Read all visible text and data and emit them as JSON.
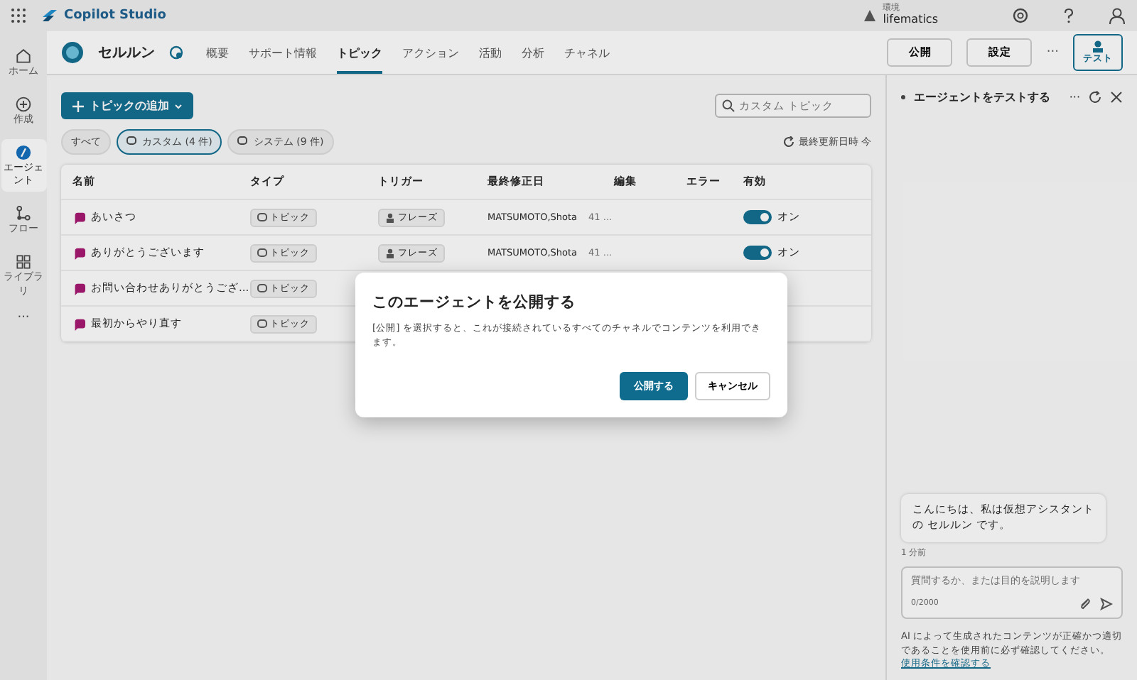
{
  "app": {
    "title": "Copilot Studio",
    "environment_label": "環境",
    "environment": "lifematics"
  },
  "rail": [
    {
      "label": "ホーム",
      "selected": false
    },
    {
      "label": "作成",
      "selected": false
    },
    {
      "label": "エージェント",
      "selected": true
    },
    {
      "label": "フロー",
      "selected": false
    },
    {
      "label": "ライブラリ",
      "selected": false
    }
  ],
  "rail_more": "···",
  "agent": {
    "name": "セルルン"
  },
  "nav_tabs": [
    {
      "label": "概要",
      "selected": false
    },
    {
      "label": "サポート情報",
      "selected": false
    },
    {
      "label": "トピック",
      "selected": true
    },
    {
      "label": "アクション",
      "selected": false
    },
    {
      "label": "活動",
      "selected": false
    },
    {
      "label": "分析",
      "selected": false
    },
    {
      "label": "チャネル",
      "selected": false
    }
  ],
  "header_buttons": [
    "公開",
    "設定"
  ],
  "header_more": "···",
  "test_button": "テスト",
  "add_topic": "トピックの追加",
  "search": {
    "placeholder": "カスタム トピック"
  },
  "filters": [
    {
      "label": "すべて",
      "selected": false
    },
    {
      "label": "カスタム (4 件)",
      "selected": true
    },
    {
      "label": "システム (9 件)",
      "selected": false
    }
  ],
  "refresh": "最終更新日時 今",
  "table": {
    "columns": [
      "名前",
      "タイプ",
      "トリガー",
      "最終修正日",
      "編集",
      "エラー",
      "有効"
    ],
    "rows": [
      {
        "name": "あいさつ",
        "type": "トピック",
        "trigger": "フレーズ",
        "modified_by": "MATSUMOTO,Shota",
        "modified": "41 ...",
        "enabled": true,
        "enabled_label": "オン"
      },
      {
        "name": "ありがとうございます",
        "type": "トピック",
        "trigger": "フレーズ",
        "modified_by": "MATSUMOTO,Shota",
        "modified": "41 ...",
        "enabled": true,
        "enabled_label": "オン"
      },
      {
        "name": "お問い合わせありがとうござ...",
        "type": "トピック"
      },
      {
        "name": "最初からやり直す",
        "type": "トピック"
      }
    ]
  },
  "test_panel": {
    "title": "エージェントをテストする",
    "more": "···",
    "message": "こんにちは、私は仮想アシスタントの セルルン です。",
    "time": "1 分前",
    "input_placeholder": "質問するか、または目的を説明します",
    "counter": "0/2000",
    "disclaimer": "AI によって生成されたコンテンツが正確かつ適切であることを使用前に必ず確認してください。",
    "terms_link": "使用条件を確認する"
  },
  "dialog": {
    "title": "このエージェントを公開する",
    "body": "[公開] を選択すると、これが接続されているすべてのチャネルでコンテンツを利用できます。",
    "primary": "公開する",
    "secondary": "キャンセル"
  }
}
